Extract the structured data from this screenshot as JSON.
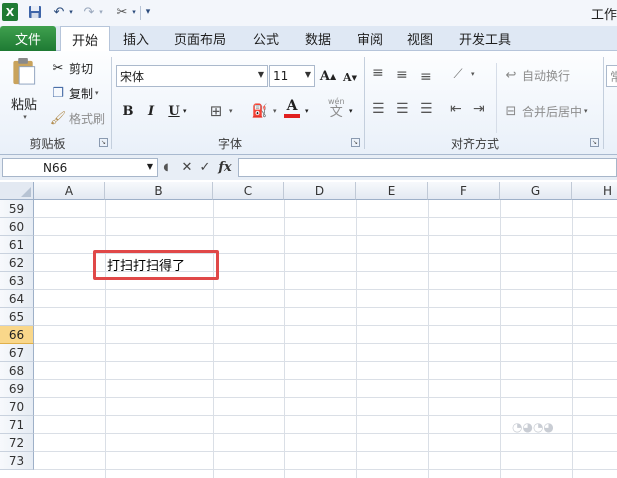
{
  "app": {
    "window_title": "工作"
  },
  "qat": {
    "icons": [
      "excel-icon",
      "save-icon",
      "undo-icon",
      "redo-icon",
      "tools-icon",
      "customize-icon"
    ]
  },
  "tabs": [
    "文件",
    "开始",
    "插入",
    "页面布局",
    "公式",
    "数据",
    "审阅",
    "视图",
    "开发工具"
  ],
  "active_tab": "开始",
  "clipboard": {
    "paste": "粘贴",
    "cut": "剪切",
    "copy": "复制",
    "format_painter": "格式刷",
    "group_label": "剪贴板"
  },
  "font": {
    "font_name": "宋体",
    "font_size": "11",
    "bold": "B",
    "italic": "I",
    "underline": "U",
    "font_color_letter": "A",
    "wen_label": "wén",
    "wen_char": "文",
    "group_label": "字体",
    "font_color": "#e02020"
  },
  "alignment": {
    "wrap_text": "自动换行",
    "merge_center": "合并后居中",
    "group_label": "对齐方式"
  },
  "number": {
    "format_partial": "常"
  },
  "formula_bar": {
    "name_box": "N66",
    "fx": "fx",
    "cancel": "✕",
    "enter": "✓"
  },
  "sheet": {
    "columns": [
      "A",
      "B",
      "C",
      "D",
      "E",
      "F",
      "G",
      "H"
    ],
    "rows": [
      "59",
      "60",
      "61",
      "62",
      "63",
      "64",
      "65",
      "66",
      "67",
      "68",
      "69",
      "70",
      "71",
      "72",
      "73"
    ],
    "selected_row": "66",
    "cell_b62": "打扫打扫得了",
    "highlight_color": "#e04848",
    "selected_row_color": "#f9d78a"
  }
}
